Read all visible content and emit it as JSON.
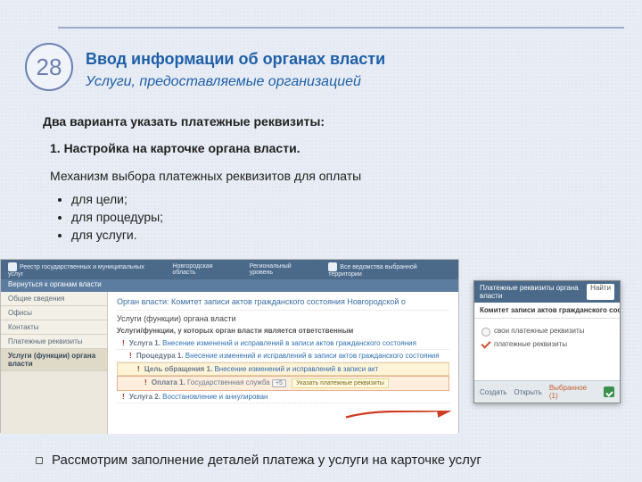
{
  "slide_number": "28",
  "title": "Ввод информации об органах власти",
  "subtitle": "Услуги, предоставляемые организацией",
  "intro": "Два варианта указать платежные реквизиты:",
  "numitem": "1.   Настройка на карточке органа власти.",
  "para": "Механизм выбора платежных реквизитов для оплаты",
  "bullets": [
    "для цели;",
    "для процедуры;",
    "для услуги."
  ],
  "footer": "Рассмотрим заполнение деталей платежа у услуги на карточке услуг",
  "mock": {
    "topbar": {
      "logo": "Реестр государственных и муниципальных услуг",
      "region": "Новгородская область",
      "level": "Региональный уровень",
      "depts": "Все ведомства выбранной территории"
    },
    "back": "Вернуться к органам власти",
    "side": [
      "Общие сведения",
      "Офисы",
      "Контакты",
      "Платежные реквизиты",
      "Услуги (функции) органа власти"
    ],
    "breadcrumb": "Орган власти: Комитет записи актов гражданского состояния Новгородской о",
    "subhead": "Услуги (функции) органа власти",
    "subhead2": "Услуги/функции, у которых орган власти является ответственным",
    "lines": {
      "l1_label": "Услуга 1.",
      "l1": "Внесение изменений и исправлений в записи актов гражданского состояния",
      "l2_label": "Процедура 1.",
      "l2": "Внесение изменений и исправлений в записи актов гражданского состояния",
      "l3_label": "Цель обращения 1.",
      "l3": "Внесение изменений и исправлений в записи акт",
      "l4_label": "Оплата 1.",
      "l4": "Государственная служба",
      "badge": "+5",
      "tip": "Указать платежные реквизиты",
      "l5_label": "Услуга 2.",
      "l5": "Восстановление и аннулирован"
    },
    "dialog": {
      "head": "Платежные реквизиты органа власти",
      "find": "Найти",
      "sub": "Комитет записи актов гражданского состояния и организаци…",
      "opt1": "свои платежные реквизиты",
      "opt2": "платежные реквизиты",
      "foot_save": "Создать",
      "foot_open": "Открыть",
      "foot_sel": "Выбранное (1)"
    }
  }
}
